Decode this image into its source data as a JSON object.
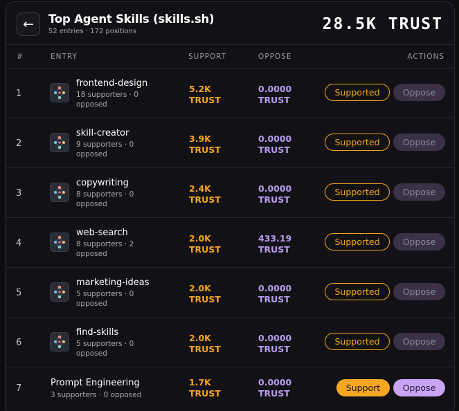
{
  "header": {
    "back_glyph": "←",
    "title": "Top Agent Skills (skills.sh)",
    "subtitle": "52 entries · 172 positions",
    "total": "28.5K TRUST"
  },
  "columns": {
    "rank": "#",
    "entry": "ENTRY",
    "support": "SUPPORT",
    "oppose": "OPPOSE",
    "actions": "ACTIONS"
  },
  "rows": [
    {
      "rank": "1",
      "name": "frontend-design",
      "meta": "18 supporters · 0 opposed",
      "support": "5.2K",
      "support_unit": "TRUST",
      "oppose": "0.0000",
      "oppose_unit": "TRUST",
      "support_btn": "Supported",
      "oppose_btn": "Oppose"
    },
    {
      "rank": "2",
      "name": "skill-creator",
      "meta": "9 supporters · 0 opposed",
      "support": "3.9K",
      "support_unit": "TRUST",
      "oppose": "0.0000",
      "oppose_unit": "TRUST",
      "support_btn": "Supported",
      "oppose_btn": "Oppose"
    },
    {
      "rank": "3",
      "name": "copywriting",
      "meta": "8 supporters · 0 opposed",
      "support": "2.4K",
      "support_unit": "TRUST",
      "oppose": "0.0000",
      "oppose_unit": "TRUST",
      "support_btn": "Supported",
      "oppose_btn": "Oppose"
    },
    {
      "rank": "4",
      "name": "web-search",
      "meta": "8 supporters · 2 opposed",
      "support": "2.0K",
      "support_unit": "TRUST",
      "oppose": "433.19",
      "oppose_unit": "TRUST",
      "support_btn": "Supported",
      "oppose_btn": "Oppose"
    },
    {
      "rank": "5",
      "name": "marketing-ideas",
      "meta": "5 supporters · 0 opposed",
      "support": "2.0K",
      "support_unit": "TRUST",
      "oppose": "0.0000",
      "oppose_unit": "TRUST",
      "support_btn": "Supported",
      "oppose_btn": "Oppose"
    },
    {
      "rank": "6",
      "name": "find-skills",
      "meta": "5 supporters · 0 opposed",
      "support": "2.0K",
      "support_unit": "TRUST",
      "oppose": "0.0000",
      "oppose_unit": "TRUST",
      "support_btn": "Supported",
      "oppose_btn": "Oppose"
    },
    {
      "rank": "7",
      "name": "Prompt Engineering",
      "meta": "3 supporters · 0 opposed",
      "support": "1.7K",
      "support_unit": "TRUST",
      "oppose": "0.0000",
      "oppose_unit": "TRUST",
      "support_btn": "Support",
      "oppose_btn": "Oppose"
    }
  ],
  "icons": {
    "back": "arrow-left-icon",
    "skill": "skill-graph-icon"
  },
  "colors": {
    "support": "#f5a623",
    "oppose": "#b89cf0",
    "oppose_button": "#c8a4f5",
    "background": "#121216"
  }
}
